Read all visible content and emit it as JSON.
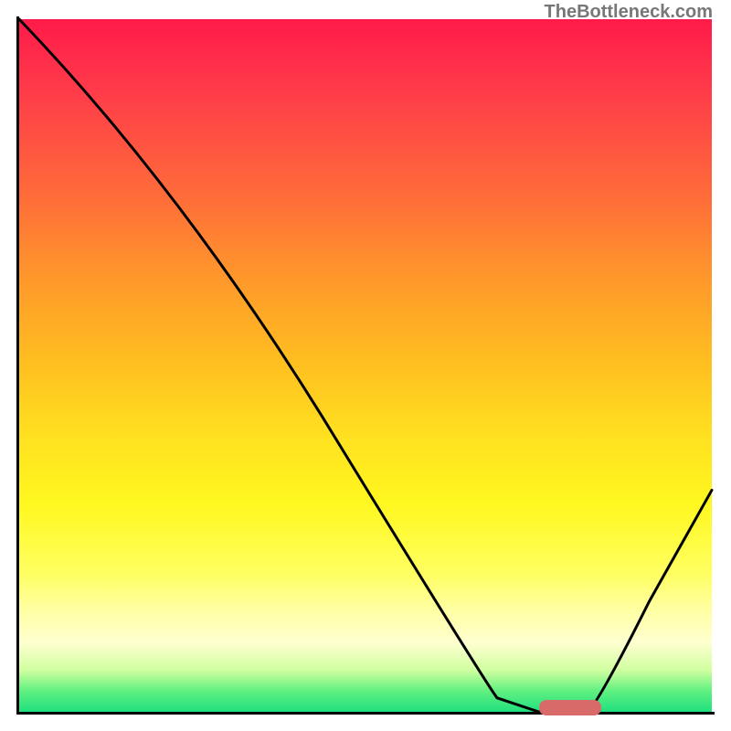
{
  "watermark": "TheBottleneck.com",
  "chart_data": {
    "type": "line",
    "title": "",
    "xlabel": "",
    "ylabel": "",
    "xlim": [
      0,
      100
    ],
    "ylim": [
      0,
      100
    ],
    "grid": false,
    "background": "heatmap-gradient-red-to-green-vertical",
    "series": [
      {
        "name": "bottleneck-curve",
        "x": [
          0,
          23,
          69,
          75,
          82,
          100
        ],
        "values": [
          100,
          76,
          2,
          0,
          0,
          32
        ]
      }
    ],
    "marker": {
      "name": "optimal-range",
      "x_start": 75,
      "x_end": 84,
      "y": 0,
      "color": "#d86a6a"
    },
    "axes": {
      "left_visible": true,
      "bottom_visible": true,
      "ticks_visible": false
    }
  }
}
